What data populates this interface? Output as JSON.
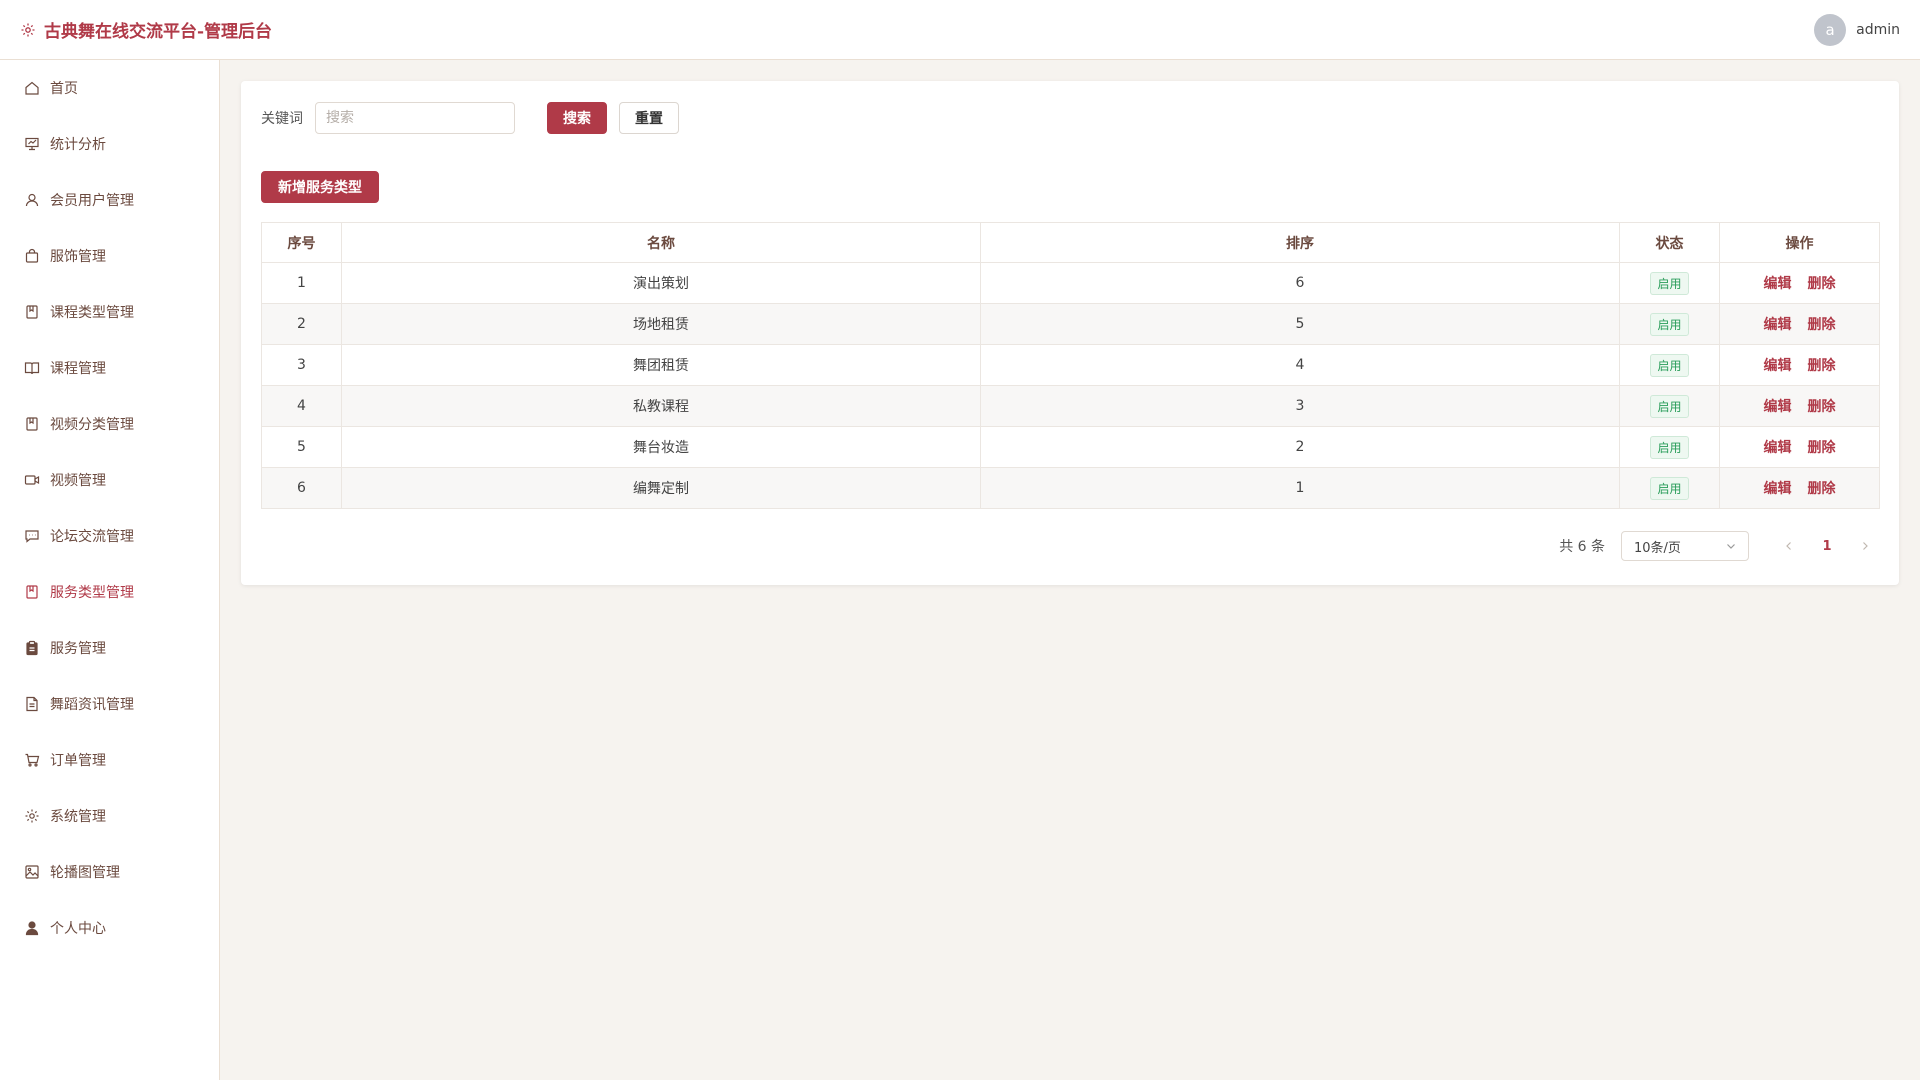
{
  "header": {
    "title": "古典舞在线交流平台-管理后台",
    "brand_icon": "gear-icon",
    "avatar_letter": "a",
    "username": "admin"
  },
  "colors": {
    "accent": "#b03a48",
    "sidebar_text": "#6b4a3f",
    "page_bg": "#f6f3ef",
    "status_green": "#2a9d5a"
  },
  "sidebar": {
    "items": [
      {
        "label": "首页",
        "icon": "home-icon"
      },
      {
        "label": "统计分析",
        "icon": "chart-icon"
      },
      {
        "label": "会员用户管理",
        "icon": "user-icon"
      },
      {
        "label": "服饰管理",
        "icon": "bag-icon"
      },
      {
        "label": "课程类型管理",
        "icon": "bookmark-icon"
      },
      {
        "label": "课程管理",
        "icon": "book-icon"
      },
      {
        "label": "视频分类管理",
        "icon": "bookmark-icon"
      },
      {
        "label": "视频管理",
        "icon": "video-icon"
      },
      {
        "label": "论坛交流管理",
        "icon": "chat-icon"
      },
      {
        "label": "服务类型管理",
        "icon": "bookmark-icon",
        "active": true
      },
      {
        "label": "服务管理",
        "icon": "clipboard-icon"
      },
      {
        "label": "舞蹈资讯管理",
        "icon": "document-icon"
      },
      {
        "label": "订单管理",
        "icon": "cart-icon"
      },
      {
        "label": "系统管理",
        "icon": "gear-icon"
      },
      {
        "label": "轮播图管理",
        "icon": "image-icon"
      },
      {
        "label": "个人中心",
        "icon": "person-icon"
      }
    ]
  },
  "search": {
    "label": "关键词",
    "placeholder": "搜索",
    "value": "",
    "search_button": "搜索",
    "reset_button": "重置"
  },
  "add_button": "新增服务类型",
  "table": {
    "columns": [
      "序号",
      "名称",
      "排序",
      "状态",
      "操作"
    ],
    "rows": [
      {
        "index": "1",
        "name": "演出策划",
        "sort": "6",
        "status": "启用"
      },
      {
        "index": "2",
        "name": "场地租赁",
        "sort": "5",
        "status": "启用"
      },
      {
        "index": "3",
        "name": "舞团租赁",
        "sort": "4",
        "status": "启用"
      },
      {
        "index": "4",
        "name": "私教课程",
        "sort": "3",
        "status": "启用"
      },
      {
        "index": "5",
        "name": "舞台妆造",
        "sort": "2",
        "status": "启用"
      },
      {
        "index": "6",
        "name": "编舞定制",
        "sort": "1",
        "status": "启用"
      }
    ],
    "edit_label": "编辑",
    "delete_label": "删除"
  },
  "pagination": {
    "total_text": "共 6 条",
    "page_size": "10条/页",
    "current_page": "1"
  }
}
